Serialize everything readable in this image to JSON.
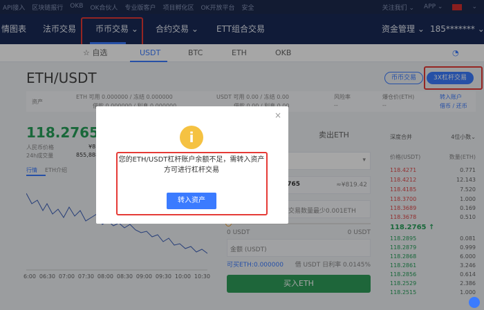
{
  "topbar": {
    "links": [
      "API接入",
      "区块链报行",
      "OKB",
      "OK合伙人",
      "专业版客户",
      "项目孵化区",
      "OK开放平台",
      "安全"
    ],
    "right": [
      "关注我们 ⌄",
      "APP ⌄",
      "",
      ""
    ]
  },
  "nav": {
    "items": [
      "情图表",
      "法币交易",
      "币币交易 ⌄",
      "合约交易 ⌄",
      "ETT组合交易"
    ],
    "asset": "资金管理 ⌄",
    "user": "185******* ⌄"
  },
  "subnav": {
    "items": [
      "☆ 自选",
      "USDT",
      "BTC",
      "ETH",
      "OKB"
    ]
  },
  "pair": "ETH/USDT",
  "buttons": {
    "coin_trade": "币币交易",
    "margin": "3X杠杆交易"
  },
  "info": {
    "left_label": "资产",
    "eth_line1": "ETH  可用  0.000000  /  冻结  0.000000",
    "eth_line2": "借款  0.000000  /  利息  0.000000",
    "usdt_line1": "USDT  可用  0.00  /  冻结  0.00",
    "usdt_line2": "借款  0.00  /  利息  0.00",
    "risk": "风险率",
    "risk_val": "--",
    "burst": "爆仓价(ETH)",
    "burst_val": "--",
    "transfer_link": "转入账户",
    "borrow_link": "借币 / 还币"
  },
  "price": "118.2765",
  "price_arrow": "↓",
  "rmb_label": "人民币价格",
  "rmb_val": "¥8",
  "vol_label": "24h成交量",
  "vol_val": "855,888",
  "tabs": [
    "行情",
    "ETH介绍"
  ],
  "chart_times": [
    "6:00",
    "06:30",
    "07:00",
    "07:30",
    "08:00",
    "08:30",
    "09:00",
    "09:30",
    "10:00",
    "10:30"
  ],
  "trade": {
    "sell_label": "卖出ETH",
    "price_val": "2765",
    "rmb": "≈¥819.42",
    "qty_placeholder": "交易数量最少0.001ETH",
    "usdt0": "0 USDT",
    "usdt0r": "0 USDT",
    "amount": "金额 (USDT)",
    "avail": "可买ETH:0.000000",
    "fee": "借 USDT 日利率 0.0145%",
    "buy": "买入ETH"
  },
  "book": {
    "depth": "深度合并",
    "decimal": "4位小数⌄",
    "col_price": "价格(USDT)",
    "col_qty": "数量(ETH)",
    "asks": [
      [
        "118.4271",
        "0.771"
      ],
      [
        "118.4212",
        "12.143"
      ],
      [
        "118.4185",
        "7.520"
      ],
      [
        "118.3700",
        "1.000"
      ],
      [
        "118.3689",
        "0.169"
      ],
      [
        "118.3678",
        "0.510"
      ]
    ],
    "mid": "118.2765 ↑",
    "bids": [
      [
        "118.2895",
        "0.081"
      ],
      [
        "118.2879",
        "0.999"
      ],
      [
        "118.2868",
        "6.000"
      ],
      [
        "118.2861",
        "3.246"
      ],
      [
        "118.2856",
        "0.614"
      ],
      [
        "118.2529",
        "2.386"
      ],
      [
        "118.2515",
        "1.000"
      ]
    ]
  },
  "dialog": {
    "message": "您的ETH/USDT杠杆账户余额不足，需转入资产方可进行杠杆交易",
    "button": "转入资产",
    "close": "×"
  }
}
